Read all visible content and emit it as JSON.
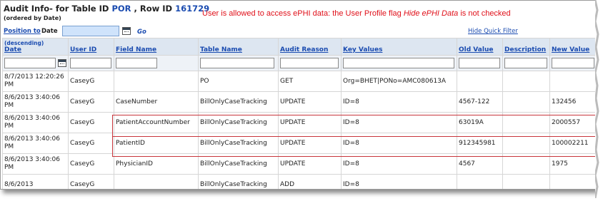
{
  "header": {
    "title_prefix": "Audit Info- for Table ID",
    "table_id": "POR",
    "row_sep": ", Row ID",
    "row_id": "161729",
    "subtitle": "(ordered by Date)",
    "warning_prefix": "User is allowed to access ePHI data: the User Profile flag ",
    "warning_flag": "Hide ePHI Data",
    "warning_suffix": " is not checked"
  },
  "filter_bar": {
    "position_link": "Position to",
    "date_label": "Date",
    "go_label": "Go",
    "hide_quick_filter": "Hide Quick Filter"
  },
  "columns": {
    "date_sort": "(descending)",
    "date": "Date",
    "user_id": "User ID",
    "field_name": "Field Name",
    "table_name": "Table Name",
    "audit_reason": "Audit Reason",
    "key_values": "Key Values",
    "old_value": "Old Value",
    "description": "Description",
    "new_value": "New Value"
  },
  "rows": [
    {
      "date": "8/7/2013 12:20:26 PM",
      "user_id": "CaseyG",
      "field_name": "",
      "table_name": "PO",
      "audit_reason": "GET",
      "key_values": "Org=BHET|PONo=AMC080613A",
      "old_value": "",
      "description": "",
      "new_value": ""
    },
    {
      "date": "8/6/2013 3:40:06 PM",
      "user_id": "CaseyG",
      "field_name": "CaseNumber",
      "table_name": "BillOnlyCaseTracking",
      "audit_reason": "UPDATE",
      "key_values": "ID=8",
      "old_value": "4567-122",
      "description": "",
      "new_value": "132456"
    },
    {
      "date": "8/6/2013 3:40:06 PM",
      "user_id": "CaseyG",
      "field_name": "PatientAccountNumber",
      "table_name": "BillOnlyCaseTracking",
      "audit_reason": "UPDATE",
      "key_values": "ID=8",
      "old_value": "63019A",
      "description": "",
      "new_value": "2000557"
    },
    {
      "date": "8/6/2013 3:40:06 PM",
      "user_id": "CaseyG",
      "field_name": "PatientID",
      "table_name": "BillOnlyCaseTracking",
      "audit_reason": "UPDATE",
      "key_values": "ID=8",
      "old_value": "912345981",
      "description": "",
      "new_value": "100002211"
    },
    {
      "date": "8/6/2013 3:40:06 PM",
      "user_id": "CaseyG",
      "field_name": "PhysicianID",
      "table_name": "BillOnlyCaseTracking",
      "audit_reason": "UPDATE",
      "key_values": "ID=8",
      "old_value": "4567",
      "description": "",
      "new_value": "1975"
    },
    {
      "date": "8/6/2013",
      "user_id": "CaseyG",
      "field_name": "",
      "table_name": "BillOnlyCaseTracking",
      "audit_reason": "ADD",
      "key_values": "ID=8",
      "old_value": "",
      "description": "",
      "new_value": ""
    }
  ]
}
